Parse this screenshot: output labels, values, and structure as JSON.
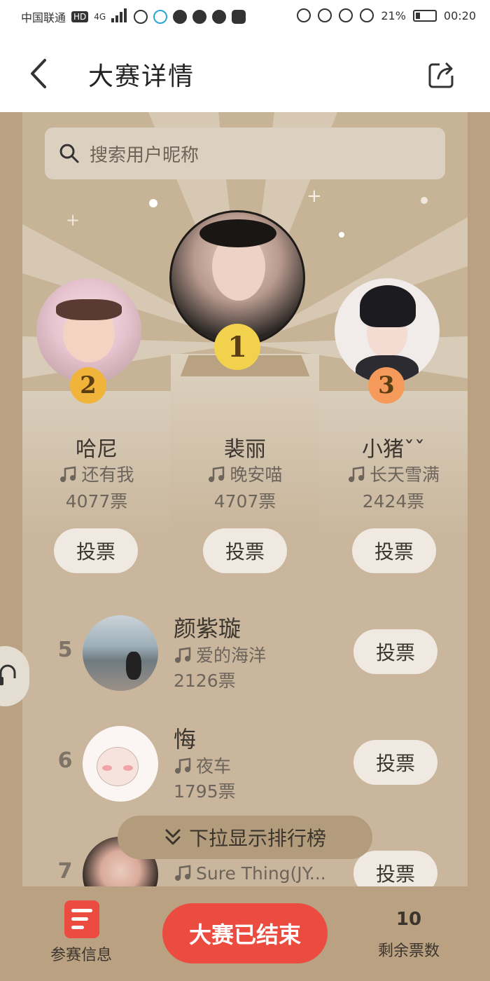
{
  "status_bar": {
    "carrier": "中国联通",
    "hd": "HD",
    "network": "4G",
    "battery": "21%",
    "time": "00:20"
  },
  "header": {
    "title": "大赛详情"
  },
  "search": {
    "placeholder": "搜索用户昵称"
  },
  "podium": [
    {
      "rank": "2",
      "name": "哈尼",
      "song": "还有我",
      "votes": "4077票",
      "vote_label": "投票"
    },
    {
      "rank": "1",
      "name": "裴丽",
      "song": "晚安喵",
      "votes": "4707票",
      "vote_label": "投票"
    },
    {
      "rank": "3",
      "name": "小猪ˇˇ",
      "song": "长天雪满",
      "votes": "2424票",
      "vote_label": "投票"
    }
  ],
  "ranking": [
    {
      "rank": "5",
      "name": "颜紫璇",
      "song": "爱的海洋",
      "votes": "2126票",
      "vote_label": "投票"
    },
    {
      "rank": "6",
      "name": "悔",
      "song": "夜车",
      "votes": "1795票",
      "vote_label": "投票"
    },
    {
      "rank": "7",
      "name": "",
      "song": "Sure Thing(JY...",
      "votes": "",
      "vote_label": "投票"
    }
  ],
  "pull_bar": {
    "label": "下拉显示排行榜"
  },
  "bottom": {
    "info_label": "参赛信息",
    "end_label": "大赛已结束",
    "remaining_count": "10",
    "remaining_label": "剩余票数"
  },
  "colors": {
    "board": "#c9b69c",
    "accent_red": "#ec4c3f",
    "gold_badge": "#f2d24c",
    "silver_badge": "#f0b43a",
    "bronze_badge": "#f59a5a"
  }
}
